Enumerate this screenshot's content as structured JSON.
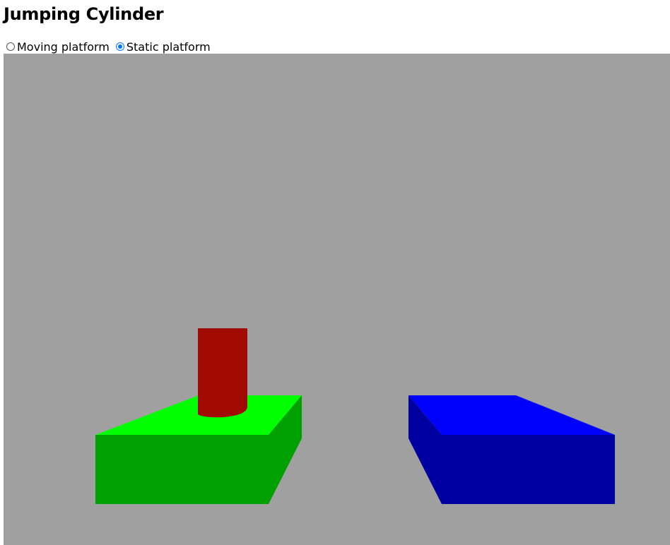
{
  "page": {
    "title": "Jumping Cylinder"
  },
  "mode_selector": {
    "options": [
      {
        "label": "Moving platform",
        "checked": false
      },
      {
        "label": "Static platform",
        "checked": true
      }
    ]
  },
  "scene": {
    "background_color": "#a0a0a0",
    "objects": [
      {
        "name": "green-platform",
        "top_color": "#00ff00",
        "front_color": "#00a000",
        "side_color": "#00a000"
      },
      {
        "name": "blue-platform",
        "top_color": "#0000ff",
        "front_color": "#0000a0",
        "side_color": "#0000a0"
      },
      {
        "name": "red-cylinder",
        "color": "#a00a00"
      }
    ]
  }
}
